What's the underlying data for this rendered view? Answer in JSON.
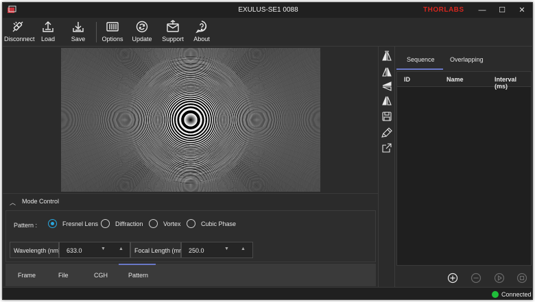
{
  "window": {
    "title": "EXULUS-SE1 0088",
    "brand": "THORLABS",
    "controls": [
      "—",
      "☐",
      "✕"
    ]
  },
  "toolbar": {
    "buttons": [
      {
        "label": "Disconnect",
        "icon": "disconnect-icon"
      },
      {
        "label": "Load",
        "icon": "load-icon"
      },
      {
        "label": "Save",
        "icon": "save-icon"
      },
      {
        "label": "Options",
        "icon": "options-icon"
      },
      {
        "label": "Update",
        "icon": "update-icon"
      },
      {
        "label": "Support",
        "icon": "support-icon"
      },
      {
        "label": "About",
        "icon": "about-icon"
      }
    ]
  },
  "mode_control": {
    "title": "Mode Control",
    "pattern_label": "Pattern :",
    "options": [
      "Fresnel Lens",
      "Diffraction",
      "Vortex",
      "Cubic Phase"
    ],
    "selected": "Fresnel Lens",
    "wavelength": {
      "label": "Wavelength (nm)",
      "value": "633.0"
    },
    "focal_length": {
      "label": "Focal Length (mm)",
      "value": "250.0"
    }
  },
  "bottom_tabs": {
    "items": [
      "Frame",
      "File",
      "CGH",
      "Pattern"
    ],
    "active": "Pattern"
  },
  "right_panel": {
    "tabs": [
      "Sequence",
      "Overlapping"
    ],
    "active": "Sequence",
    "columns": [
      "ID",
      "Name",
      "Interval (ms)"
    ],
    "rows": []
  },
  "status": {
    "text": "Connected",
    "color": "#1fbf3a"
  },
  "colors": {
    "accent": "#2aa8e0",
    "tab_indicator": "#6a78c8",
    "brand": "#d7261e"
  }
}
